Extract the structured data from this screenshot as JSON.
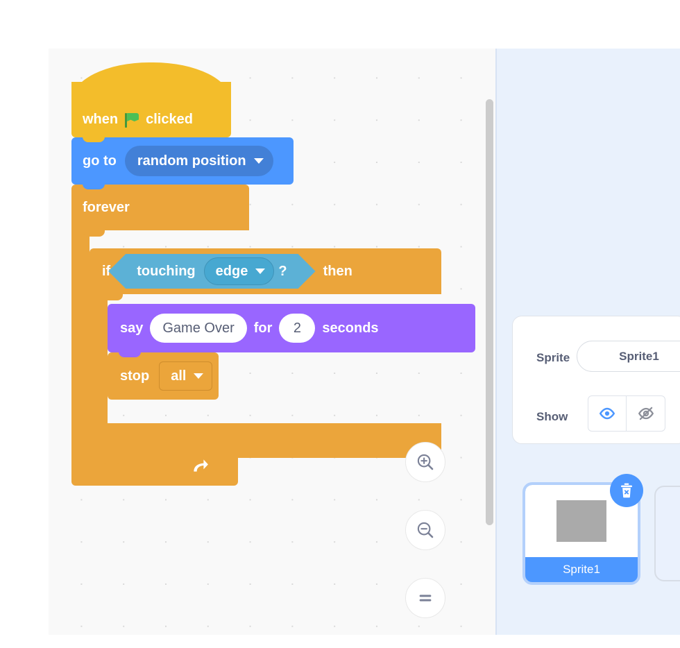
{
  "workspace": {
    "name": "code-canvas",
    "background_color": "#f9f9f9",
    "grid_dot_color": "#d9d9d9"
  },
  "script": {
    "hat": {
      "label_before": "when",
      "label_after": "clicked",
      "icon": "green-flag-icon",
      "color": "#f3bd2b"
    },
    "goto": {
      "label": "go to",
      "dropdown_value": "random position",
      "color": "#4c97ff"
    },
    "forever": {
      "label": "forever",
      "color": "#eba53b",
      "icon": "loop-arrow-icon"
    },
    "if_then": {
      "label_if": "if",
      "label_then": "then",
      "color": "#eba53b"
    },
    "touching": {
      "label": "touching",
      "dropdown_value": "edge",
      "question_mark": "?",
      "color": "#5cb1d6"
    },
    "say": {
      "label_say": "say",
      "message": "Game Over",
      "label_for": "for",
      "duration": "2",
      "label_seconds": "seconds",
      "color": "#9966ff"
    },
    "stop": {
      "label": "stop",
      "dropdown_value": "all",
      "color": "#eba53b"
    }
  },
  "zoom_controls": {
    "zoom_in": "zoom-in",
    "zoom_out": "zoom-out",
    "zoom_reset": "zoom-reset"
  },
  "sprite_info": {
    "sprite_label": "Sprite",
    "sprite_name": "Sprite1",
    "show_label": "Show",
    "show_on_icon": "eye-visible-icon",
    "show_off_icon": "eye-hidden-icon",
    "show_active": "on",
    "accent_color": "#4c97ff"
  },
  "sprite_list": {
    "selected": "Sprite1",
    "items": [
      {
        "name": "Sprite1"
      }
    ],
    "delete_icon": "trash-delete-icon"
  }
}
